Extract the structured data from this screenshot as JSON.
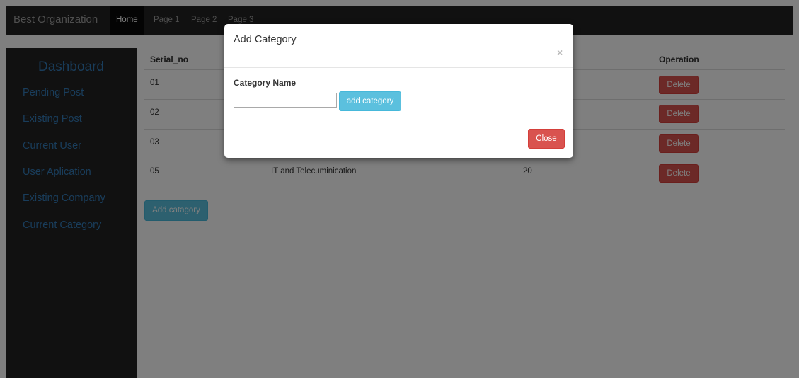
{
  "navbar": {
    "brand": "Best Organization",
    "items": [
      {
        "label": "Home",
        "active": true
      },
      {
        "label": "Page 1",
        "active": false
      },
      {
        "label": "Page 2",
        "active": false
      },
      {
        "label": "Page 3",
        "active": false
      }
    ]
  },
  "sidebar": {
    "title": "Dashboard",
    "links": [
      "Pending Post",
      "Existing Post",
      "Current User",
      "User Aplication",
      "Existing Company",
      "Current Category"
    ]
  },
  "table": {
    "headers": {
      "serial": "Serial_no",
      "operation": "Operation"
    },
    "rows": [
      {
        "serial": "01",
        "name": "",
        "count": "",
        "action": "Delete"
      },
      {
        "serial": "02",
        "name": "",
        "count": "",
        "action": "Delete"
      },
      {
        "serial": "03",
        "name": "",
        "count": "",
        "action": "Delete"
      },
      {
        "serial": "05",
        "name": "IT and Telecuminication",
        "count": "20",
        "action": "Delete"
      }
    ]
  },
  "main": {
    "add_button": "Add catagory"
  },
  "modal": {
    "title": "Add Category",
    "close_icon": "×",
    "field_label": "Category Name",
    "input_value": "",
    "input_placeholder": "",
    "submit_button": "add category",
    "close_button": "Close"
  },
  "colors": {
    "navbar_bg": "#222222",
    "link_blue": "#337ab7",
    "danger": "#d9534f",
    "info": "#5bc0de"
  }
}
